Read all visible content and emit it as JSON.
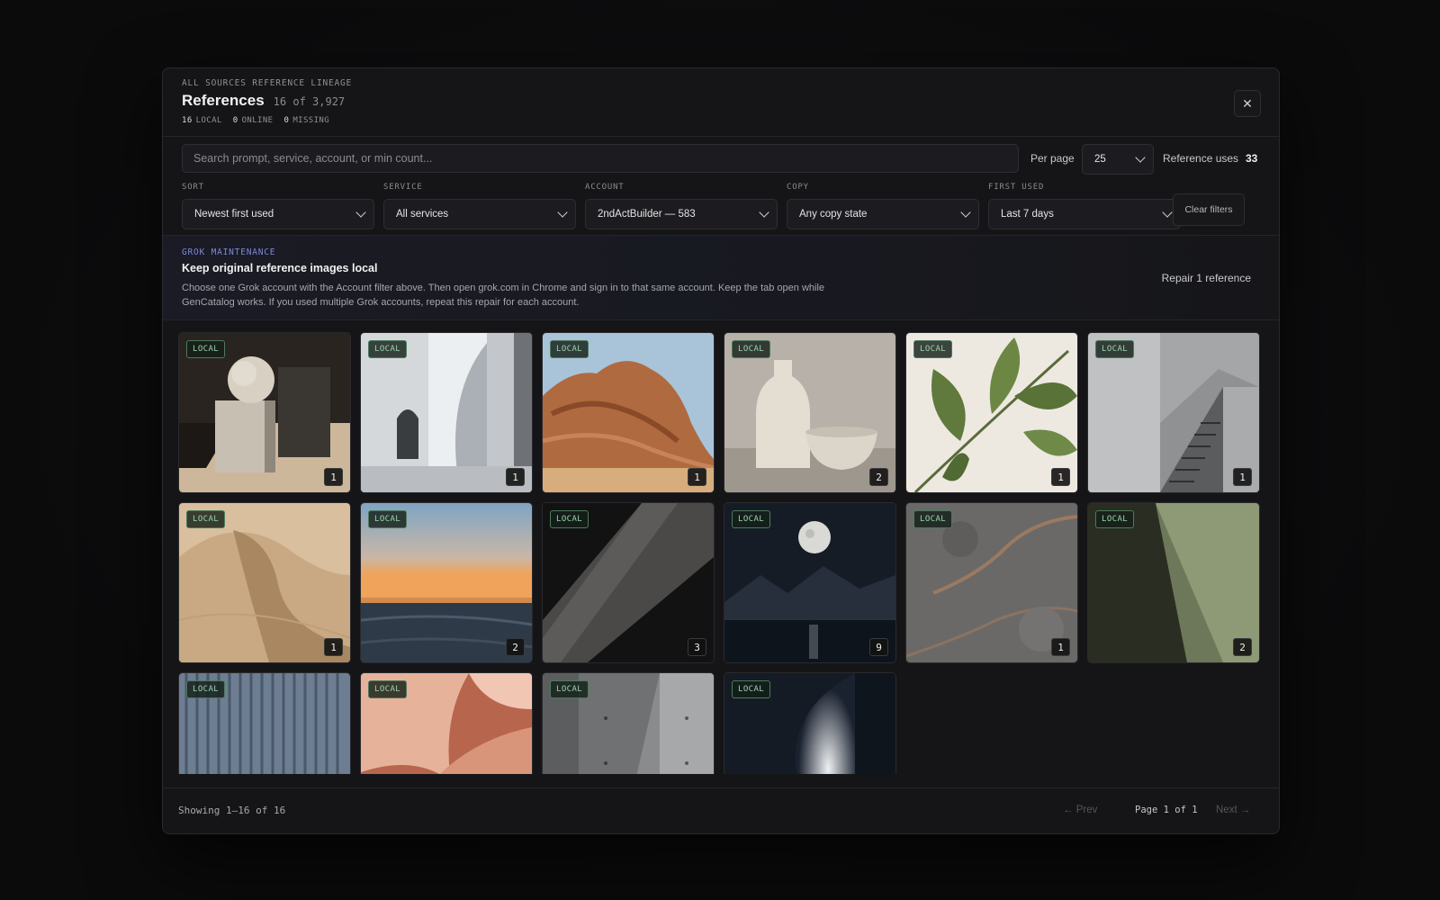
{
  "modal": {
    "overline": "ALL SOURCES REFERENCE LINEAGE",
    "title": "References",
    "title_count": "16 of 3,927",
    "stats": {
      "local_count": "16",
      "local_label": "LOCAL",
      "online_count": "0",
      "online_label": "ONLINE",
      "missing_count": "0",
      "missing_label": "MISSING"
    },
    "close_icon": "close-icon"
  },
  "search": {
    "placeholder": "Search prompt, service, account, or min count...",
    "per_page_label": "Per page",
    "per_page_value": "25",
    "reference_uses_label": "Reference uses",
    "reference_uses_value": "33"
  },
  "filters": {
    "sort": {
      "label": "SORT",
      "value": "Newest first used"
    },
    "service": {
      "label": "SERVICE",
      "value": "All services"
    },
    "account": {
      "label": "ACCOUNT",
      "value": "2ndActBuilder — 583"
    },
    "copy": {
      "label": "COPY",
      "value": "Any copy state"
    },
    "first_used": {
      "label": "FIRST USED",
      "value": "Last 7 days"
    },
    "clear_label": "Clear filters"
  },
  "banner": {
    "tag": "GROK MAINTENANCE",
    "title": "Keep original reference images local",
    "body": "Choose one Grok account with the Account filter above. Then open grok.com in Chrome and sign in to that same account. Keep the tab open while GenCatalog works. If you used multiple Grok accounts, repeat this repair for each account.",
    "repair_label": "Repair 1 reference",
    "accent": "#7d88d8"
  },
  "tiles": [
    {
      "badge": "LOCAL",
      "count": "1",
      "scene": "geometric-sphere-cube"
    },
    {
      "badge": "LOCAL",
      "count": "1",
      "scene": "white-architecture-arch"
    },
    {
      "badge": "LOCAL",
      "count": "1",
      "scene": "red-rock-formation"
    },
    {
      "badge": "LOCAL",
      "count": "2",
      "scene": "ceramic-vase-bowl"
    },
    {
      "badge": "LOCAL",
      "count": "1",
      "scene": "green-leaves"
    },
    {
      "badge": "LOCAL",
      "count": "1",
      "scene": "concrete-staircase"
    },
    {
      "badge": "LOCAL",
      "count": "1",
      "scene": "sand-dune"
    },
    {
      "badge": "LOCAL",
      "count": "2",
      "scene": "ocean-sunset"
    },
    {
      "badge": "LOCAL",
      "count": "3",
      "scene": "dark-diagonal-shadow"
    },
    {
      "badge": "LOCAL",
      "count": "9",
      "scene": "moon-over-lake"
    },
    {
      "badge": "LOCAL",
      "count": "1",
      "scene": "stone-texture"
    },
    {
      "badge": "LOCAL",
      "count": "2",
      "scene": "olive-wall-shadow"
    },
    {
      "badge": "LOCAL",
      "count": "",
      "scene": "blue-corrugated-metal"
    },
    {
      "badge": "LOCAL",
      "count": "",
      "scene": "pink-paper-curves"
    },
    {
      "badge": "LOCAL",
      "count": "",
      "scene": "concrete-wall-shadow"
    },
    {
      "badge": "LOCAL",
      "count": "",
      "scene": "light-curve-dark"
    }
  ],
  "footer": {
    "showing": "Showing 1–16 of 16",
    "prev": "← Prev",
    "page": "Page 1 of 1",
    "next": "Next →"
  },
  "colors": {
    "local_badge": "#9fd3b0",
    "background": "#0c0c0d",
    "panel": "#151517"
  }
}
